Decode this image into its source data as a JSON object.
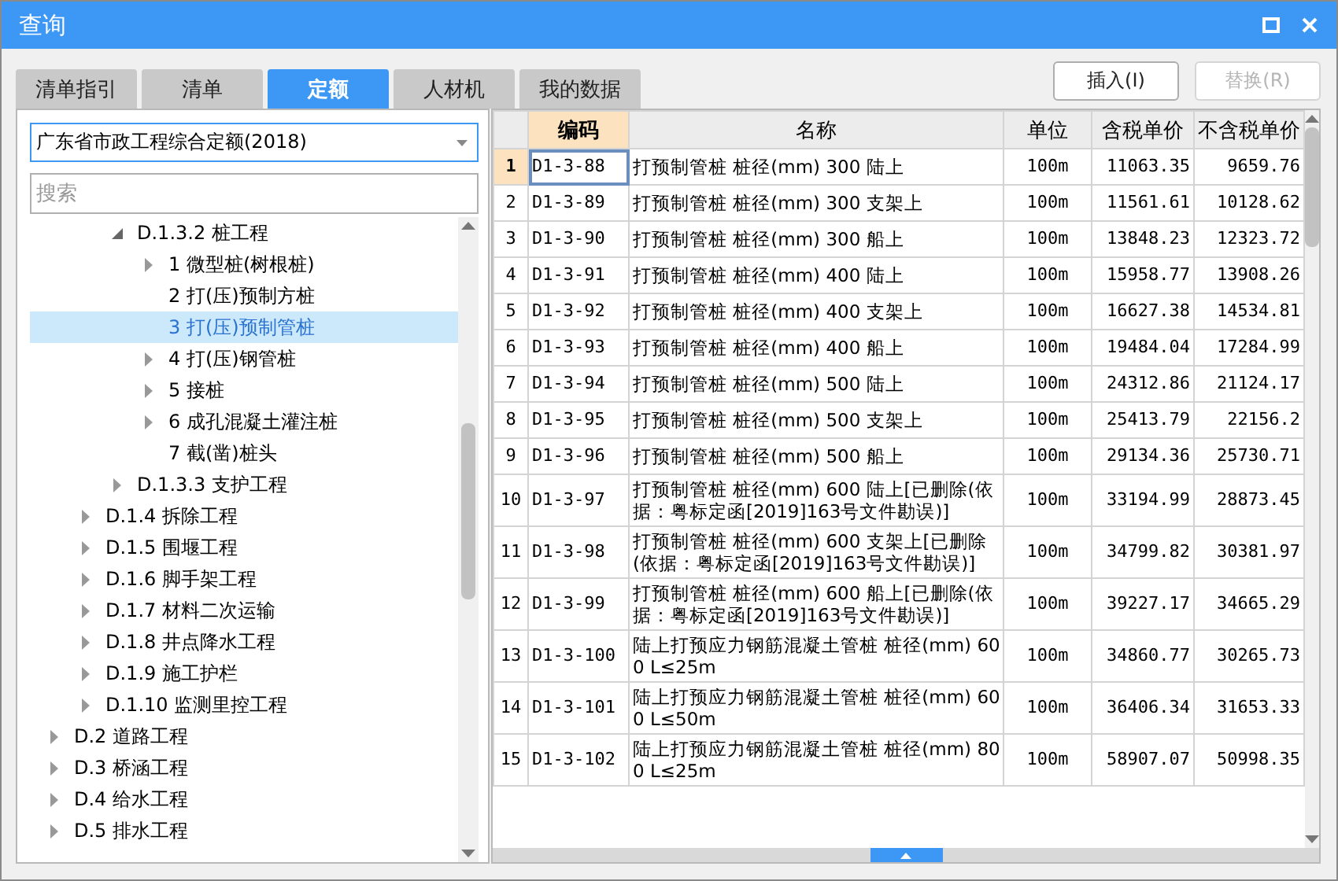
{
  "window": {
    "title": "查询"
  },
  "tabs": [
    {
      "label": "清单指引",
      "selected": false
    },
    {
      "label": "清单",
      "selected": false
    },
    {
      "label": "定额",
      "selected": true
    },
    {
      "label": "人材机",
      "selected": false
    },
    {
      "label": "我的数据",
      "selected": false
    }
  ],
  "buttons": [
    {
      "label": "插入(I)",
      "disabled": false
    },
    {
      "label": "替换(R)",
      "disabled": true
    }
  ],
  "library_select": {
    "value": "广东省市政工程综合定额(2018)"
  },
  "search": {
    "placeholder": "搜索"
  },
  "tree": [
    {
      "children": [
        {
          "children": [
            {
              "label": "D.1.3.2 桩工程",
              "expandable": true,
              "expanded": true,
              "selected": false,
              "children": [
                {
                  "label": "1 微型桩(树根桩)",
                  "expandable": true,
                  "expanded": false,
                  "selected": false
                },
                {
                  "label": "2 打(压)预制方桩",
                  "expandable": false,
                  "selected": false
                },
                {
                  "label": "3 打(压)预制管桩",
                  "expandable": false,
                  "selected": true
                },
                {
                  "label": "4 打(压)钢管桩",
                  "expandable": true,
                  "expanded": false,
                  "selected": false
                },
                {
                  "label": "5 接桩",
                  "expandable": true,
                  "expanded": false,
                  "selected": false
                },
                {
                  "label": "6 成孔混凝土灌注桩",
                  "expandable": true,
                  "expanded": false,
                  "selected": false
                },
                {
                  "label": "7 截(凿)桩头",
                  "expandable": false,
                  "selected": false
                }
              ]
            },
            {
              "label": "D.1.3.3 支护工程",
              "expandable": true,
              "expanded": false,
              "selected": false
            }
          ]
        },
        {
          "label": "D.1.4 拆除工程",
          "expandable": true,
          "expanded": false,
          "selected": false
        },
        {
          "label": "D.1.5 围堰工程",
          "expandable": true,
          "expanded": false,
          "selected": false
        },
        {
          "label": "D.1.6 脚手架工程",
          "expandable": true,
          "expanded": false,
          "selected": false
        },
        {
          "label": "D.1.7 材料二次运输",
          "expandable": true,
          "expanded": false,
          "selected": false
        },
        {
          "label": "D.1.8 井点降水工程",
          "expandable": true,
          "expanded": false,
          "selected": false
        },
        {
          "label": "D.1.9 施工护栏",
          "expandable": true,
          "expanded": false,
          "selected": false
        },
        {
          "label": "D.1.10 监测里控工程",
          "expandable": true,
          "expanded": false,
          "selected": false
        }
      ]
    },
    {
      "label": "D.2 道路工程",
      "expandable": true,
      "expanded": false,
      "selected": false
    },
    {
      "label": "D.3 桥涵工程",
      "expandable": true,
      "expanded": false,
      "selected": false
    },
    {
      "label": "D.4 给水工程",
      "expandable": true,
      "expanded": false,
      "selected": false
    },
    {
      "label": "D.5 排水工程",
      "expandable": true,
      "expanded": false,
      "selected": false
    }
  ],
  "table": {
    "columns": [
      "编码",
      "名称",
      "单位",
      "含税单价",
      "不含税单价"
    ],
    "rows": [
      {
        "num": "1",
        "code": "D1-3-88",
        "name": "打预制管桩 桩径(mm) 300 陆上",
        "unit": "100m",
        "price_tax": "11063.35",
        "price_notax": "9659.76",
        "selected": true
      },
      {
        "num": "2",
        "code": "D1-3-89",
        "name": "打预制管桩 桩径(mm) 300 支架上",
        "unit": "100m",
        "price_tax": "11561.61",
        "price_notax": "10128.62",
        "selected": false
      },
      {
        "num": "3",
        "code": "D1-3-90",
        "name": "打预制管桩 桩径(mm) 300 船上",
        "unit": "100m",
        "price_tax": "13848.23",
        "price_notax": "12323.72",
        "selected": false
      },
      {
        "num": "4",
        "code": "D1-3-91",
        "name": "打预制管桩 桩径(mm) 400 陆上",
        "unit": "100m",
        "price_tax": "15958.77",
        "price_notax": "13908.26",
        "selected": false
      },
      {
        "num": "5",
        "code": "D1-3-92",
        "name": "打预制管桩 桩径(mm) 400 支架上",
        "unit": "100m",
        "price_tax": "16627.38",
        "price_notax": "14534.81",
        "selected": false
      },
      {
        "num": "6",
        "code": "D1-3-93",
        "name": "打预制管桩 桩径(mm) 400 船上",
        "unit": "100m",
        "price_tax": "19484.04",
        "price_notax": "17284.99",
        "selected": false
      },
      {
        "num": "7",
        "code": "D1-3-94",
        "name": "打预制管桩 桩径(mm) 500 陆上",
        "unit": "100m",
        "price_tax": "24312.86",
        "price_notax": "21124.17",
        "selected": false
      },
      {
        "num": "8",
        "code": "D1-3-95",
        "name": "打预制管桩 桩径(mm) 500 支架上",
        "unit": "100m",
        "price_tax": "25413.79",
        "price_notax": "22156.2",
        "selected": false
      },
      {
        "num": "9",
        "code": "D1-3-96",
        "name": "打预制管桩 桩径(mm) 500 船上",
        "unit": "100m",
        "price_tax": "29134.36",
        "price_notax": "25730.71",
        "selected": false
      },
      {
        "num": "10",
        "code": "D1-3-97",
        "name": "打预制管桩 桩径(mm) 600 陆上[已删除(依据：粤标定函[2019]163号文件勘误)]",
        "unit": "100m",
        "price_tax": "33194.99",
        "price_notax": "28873.45",
        "selected": false
      },
      {
        "num": "11",
        "code": "D1-3-98",
        "name": "打预制管桩 桩径(mm) 600 支架上[已删除(依据：粤标定函[2019]163号文件勘误)]",
        "unit": "100m",
        "price_tax": "34799.82",
        "price_notax": "30381.97",
        "selected": false
      },
      {
        "num": "12",
        "code": "D1-3-99",
        "name": "打预制管桩 桩径(mm) 600 船上[已删除(依据：粤标定函[2019]163号文件勘误)]",
        "unit": "100m",
        "price_tax": "39227.17",
        "price_notax": "34665.29",
        "selected": false
      },
      {
        "num": "13",
        "code": "D1-3-100",
        "name": "陆上打预应力钢筋混凝土管桩 桩径(mm) 600 L≤25m",
        "unit": "100m",
        "price_tax": "34860.77",
        "price_notax": "30265.73",
        "selected": false
      },
      {
        "num": "14",
        "code": "D1-3-101",
        "name": "陆上打预应力钢筋混凝土管桩 桩径(mm) 600 L≤50m",
        "unit": "100m",
        "price_tax": "36406.34",
        "price_notax": "31653.33",
        "selected": false
      },
      {
        "num": "15",
        "code": "D1-3-102",
        "name": "陆上打预应力钢筋混凝土管桩 桩径(mm) 800 L≤25m",
        "unit": "100m",
        "price_tax": "58907.07",
        "price_notax": "50998.35",
        "selected": false
      }
    ]
  }
}
